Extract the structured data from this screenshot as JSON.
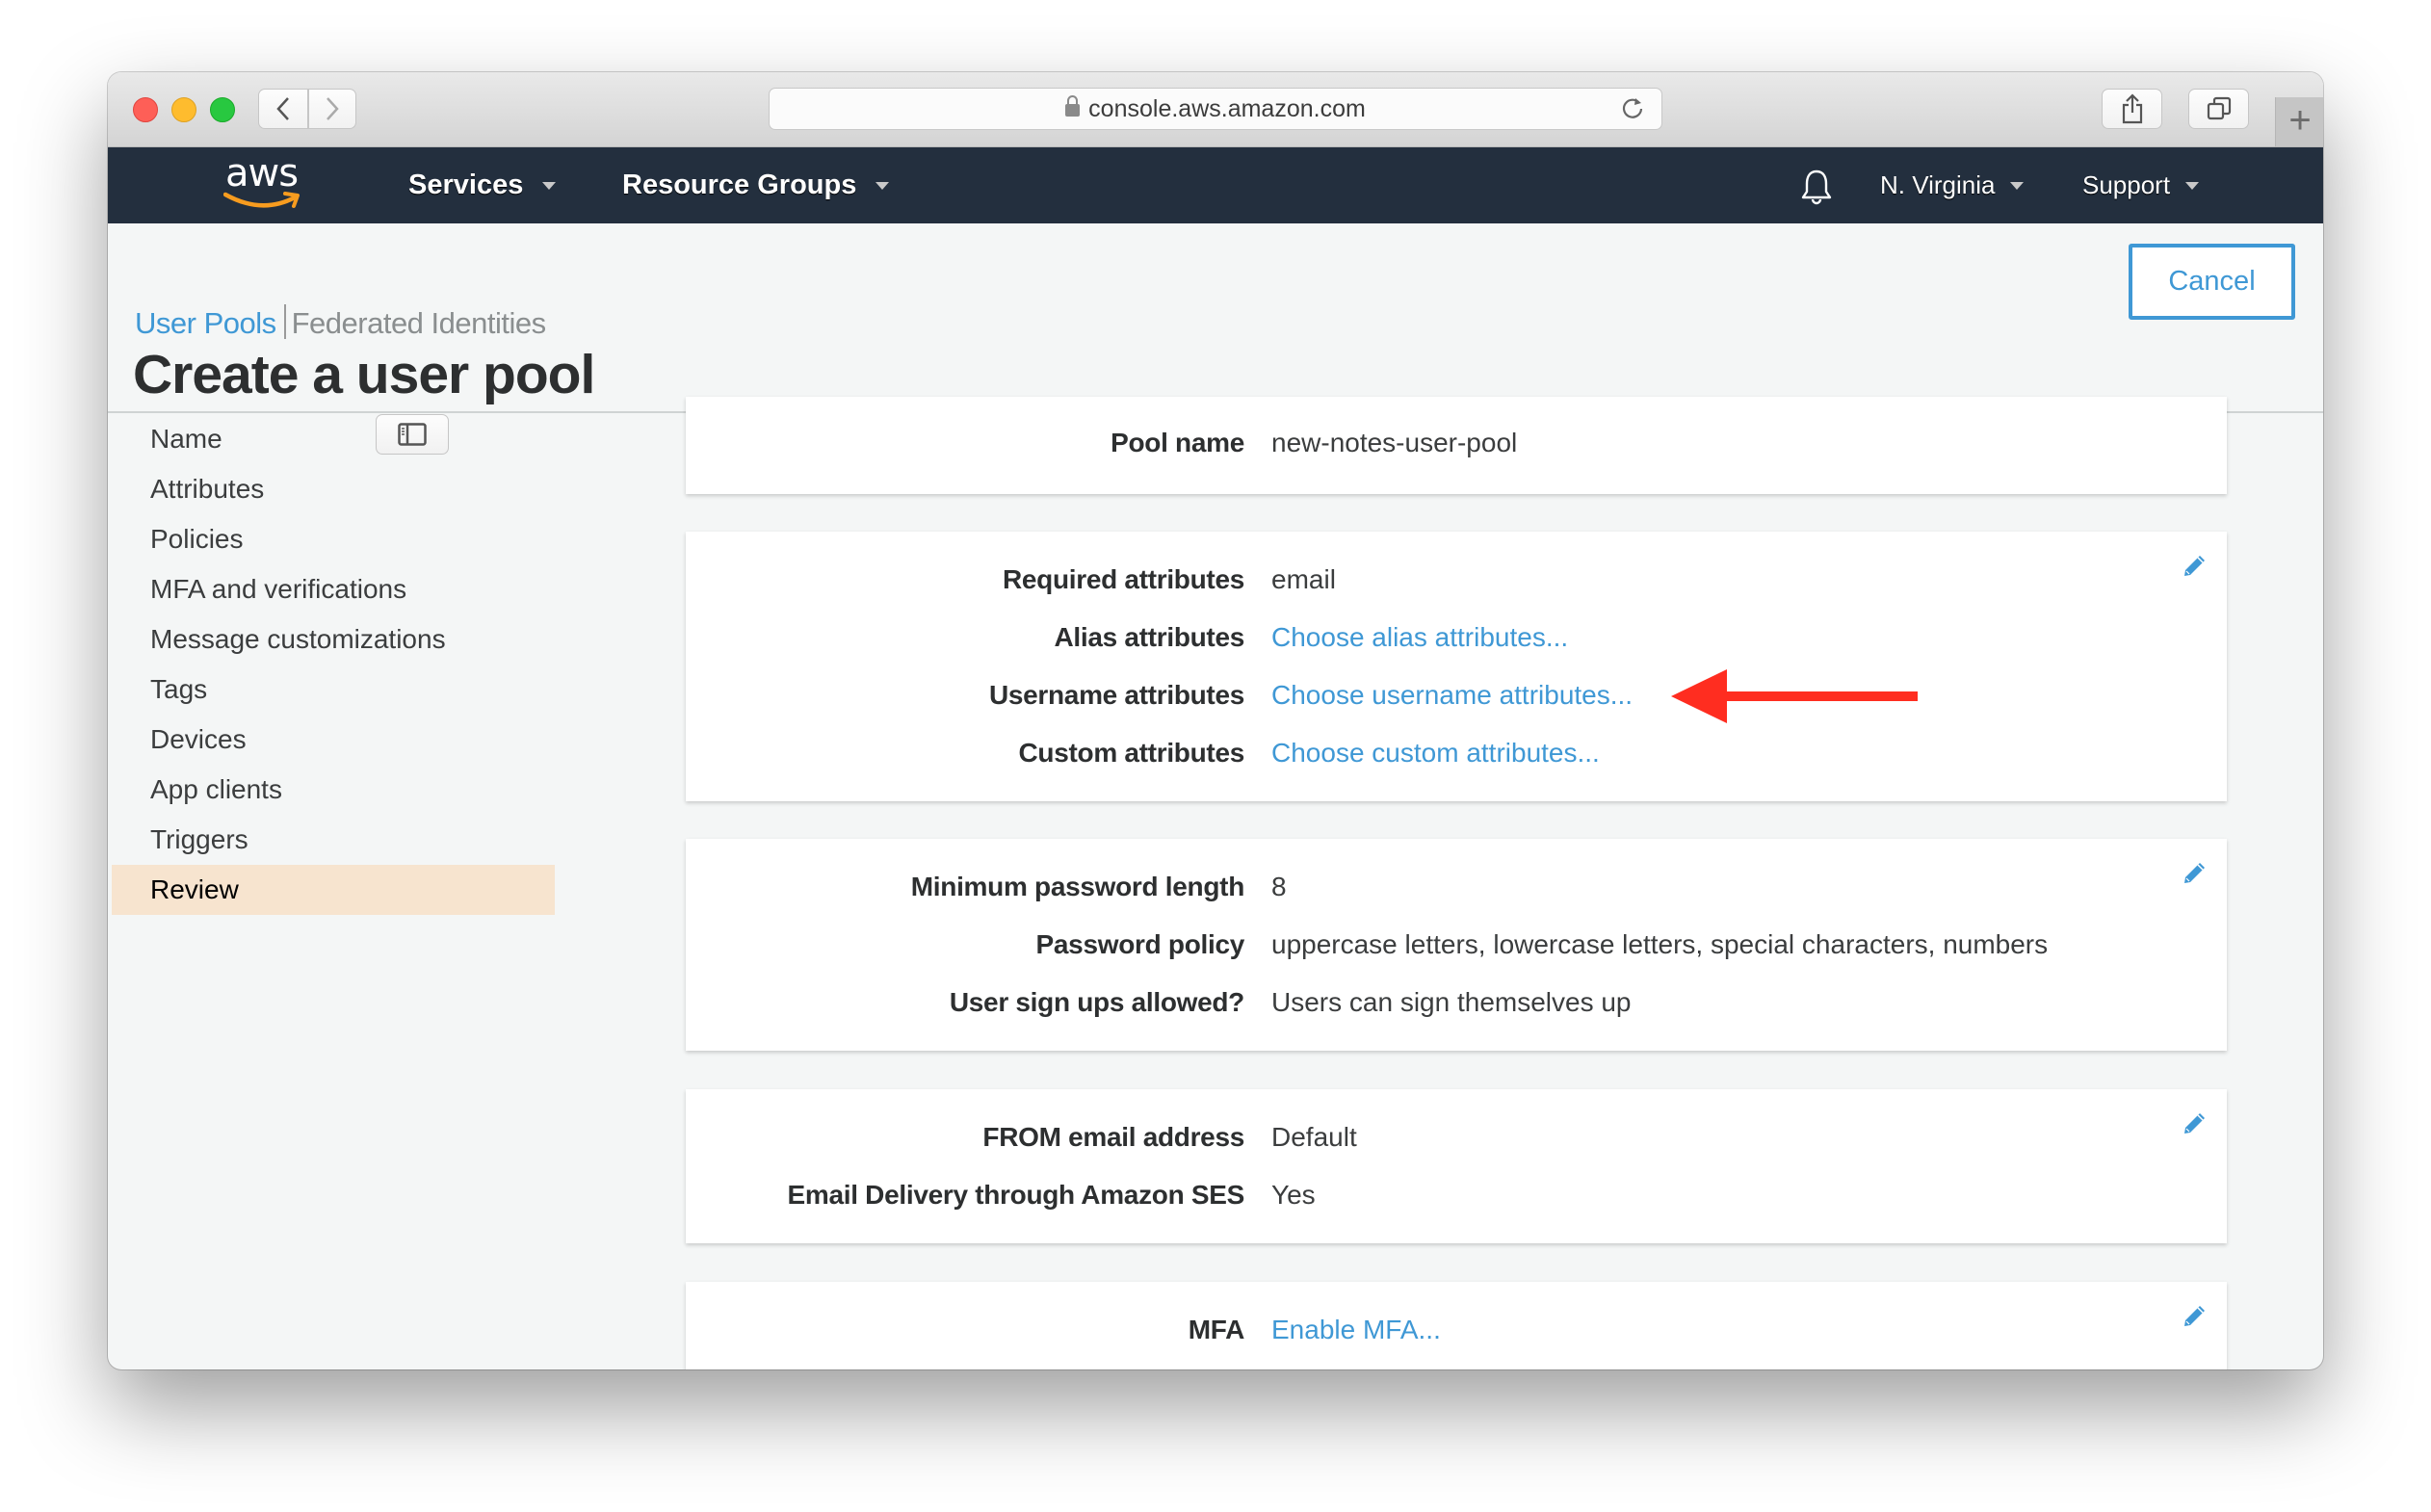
{
  "browser": {
    "url": "console.aws.amazon.com",
    "icons": {
      "back": "chevron-left-icon",
      "forward": "chevron-right-icon",
      "sidebar": "sidebar-icon",
      "lock": "lock-icon",
      "reload": "reload-icon",
      "share": "share-icon",
      "tabs": "tabs-icon",
      "new_tab": "plus-icon"
    },
    "new_tab_glyph": "+"
  },
  "nav": {
    "logo_text": "aws",
    "services": "Services",
    "resource_groups": "Resource Groups",
    "region": "N. Virginia",
    "support": "Support",
    "colors": {
      "background": "#232f3e",
      "logo_smile": "#f79c1f"
    }
  },
  "header": {
    "breadcrumb": {
      "active": "User Pools",
      "inactive": "Federated Identities"
    },
    "title": "Create a user pool",
    "cancel_label": "Cancel",
    "accent_color": "#3f98d5"
  },
  "sidebar": {
    "items": [
      {
        "label": "Name",
        "active": false
      },
      {
        "label": "Attributes",
        "active": false
      },
      {
        "label": "Policies",
        "active": false
      },
      {
        "label": "MFA and verifications",
        "active": false
      },
      {
        "label": "Message customizations",
        "active": false
      },
      {
        "label": "Tags",
        "active": false
      },
      {
        "label": "Devices",
        "active": false
      },
      {
        "label": "App clients",
        "active": false
      },
      {
        "label": "Triggers",
        "active": false
      },
      {
        "label": "Review",
        "active": true
      }
    ],
    "active_color": "#f7e4cf"
  },
  "review": {
    "cards": [
      {
        "editable": false,
        "rows": [
          {
            "label": "Pool name",
            "value": "new-notes-user-pool",
            "link": false
          }
        ]
      },
      {
        "editable": true,
        "rows": [
          {
            "label": "Required attributes",
            "value": "email",
            "link": false
          },
          {
            "label": "Alias attributes",
            "value": "Choose alias attributes...",
            "link": true
          },
          {
            "label": "Username attributes",
            "value": "Choose username attributes...",
            "link": true
          },
          {
            "label": "Custom attributes",
            "value": "Choose custom attributes...",
            "link": true
          }
        ]
      },
      {
        "editable": true,
        "rows": [
          {
            "label": "Minimum password length",
            "value": "8",
            "link": false
          },
          {
            "label": "Password policy",
            "value": "uppercase letters, lowercase letters, special characters, numbers",
            "link": false
          },
          {
            "label": "User sign ups allowed?",
            "value": "Users can sign themselves up",
            "link": false
          }
        ]
      },
      {
        "editable": true,
        "rows": [
          {
            "label": "FROM email address",
            "value": "Default",
            "link": false
          },
          {
            "label": "Email Delivery through Amazon SES",
            "value": "Yes",
            "link": false
          }
        ]
      },
      {
        "editable": true,
        "rows": [
          {
            "label": "MFA",
            "value": "Enable MFA...",
            "link": true
          }
        ]
      }
    ],
    "edit_icon": "pencil-icon"
  },
  "annotation": {
    "type": "arrow",
    "direction": "left",
    "points_to": "Choose username attributes...",
    "color": "#ff2d20"
  }
}
